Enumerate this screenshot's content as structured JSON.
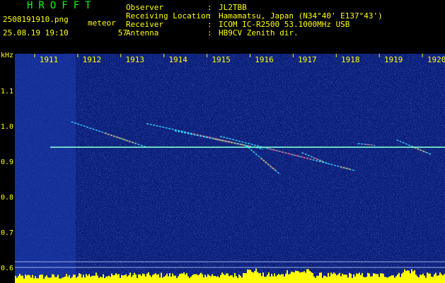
{
  "app": {
    "brand": "HROFFT",
    "file_name": "2508191910.png",
    "date_time": "25.08.19 19:10",
    "meteor_label": "meteor",
    "meteor_count": "57"
  },
  "station": {
    "rows": [
      {
        "label": "Observer",
        "sep": ":",
        "value": "JL2TBB"
      },
      {
        "label": "Receiving Location",
        "sep": ":",
        "value": "Hamamatsu, Japan (N34°40' E137°43')"
      },
      {
        "label": "Receiver",
        "sep": ":",
        "value": "ICOM IC-R2500 53.1000MHz USB"
      },
      {
        "label": "Antenna",
        "sep": ":",
        "value": "HB9CV Zenith dir."
      }
    ]
  },
  "colors": {
    "background": "#000000",
    "text": "#ffff00",
    "brand": "#00ff00",
    "spectrogram_base": "#0a1e78",
    "carrier": "#7fffd4",
    "meteor_hot": "#ff4060",
    "noise_bar": "#ffff00"
  },
  "chart_data": {
    "type": "heatmap",
    "ylabel": "kHz",
    "y_ticks": [
      "1.1",
      "1.0",
      "0.9",
      "0.8",
      "0.7",
      "0.6"
    ],
    "x_ticks": [
      "1911",
      "1912",
      "1913",
      "1914",
      "1915",
      "1916",
      "1917",
      "1918",
      "1919",
      "1920"
    ],
    "ylim": [
      0.6,
      1.2
    ],
    "carrier_khz": 0.935,
    "meteor_echoes": [
      {
        "start_min": 1911.85,
        "end_min": 1913.6,
        "khz_start": 1.005,
        "khz_end": 0.935
      },
      {
        "start_min": 1913.6,
        "end_min": 1915.9,
        "khz_start": 1.0,
        "khz_end": 0.94
      },
      {
        "start_min": 1914.25,
        "end_min": 1916.3,
        "khz_start": 0.98,
        "khz_end": 0.93
      },
      {
        "start_min": 1915.3,
        "end_min": 1917.8,
        "khz_start": 0.965,
        "khz_end": 0.89
      },
      {
        "start_min": 1915.9,
        "end_min": 1916.7,
        "khz_start": 0.94,
        "khz_end": 0.86
      },
      {
        "start_min": 1917.2,
        "end_min": 1917.8,
        "khz_start": 0.92,
        "khz_end": 0.89
      },
      {
        "start_min": 1917.8,
        "end_min": 1918.45,
        "khz_start": 0.89,
        "khz_end": 0.87
      },
      {
        "start_min": 1918.5,
        "end_min": 1918.9,
        "khz_start": 0.945,
        "khz_end": 0.94
      },
      {
        "start_min": 1919.4,
        "end_min": 1920.2,
        "khz_start": 0.955,
        "khz_end": 0.915
      }
    ]
  }
}
